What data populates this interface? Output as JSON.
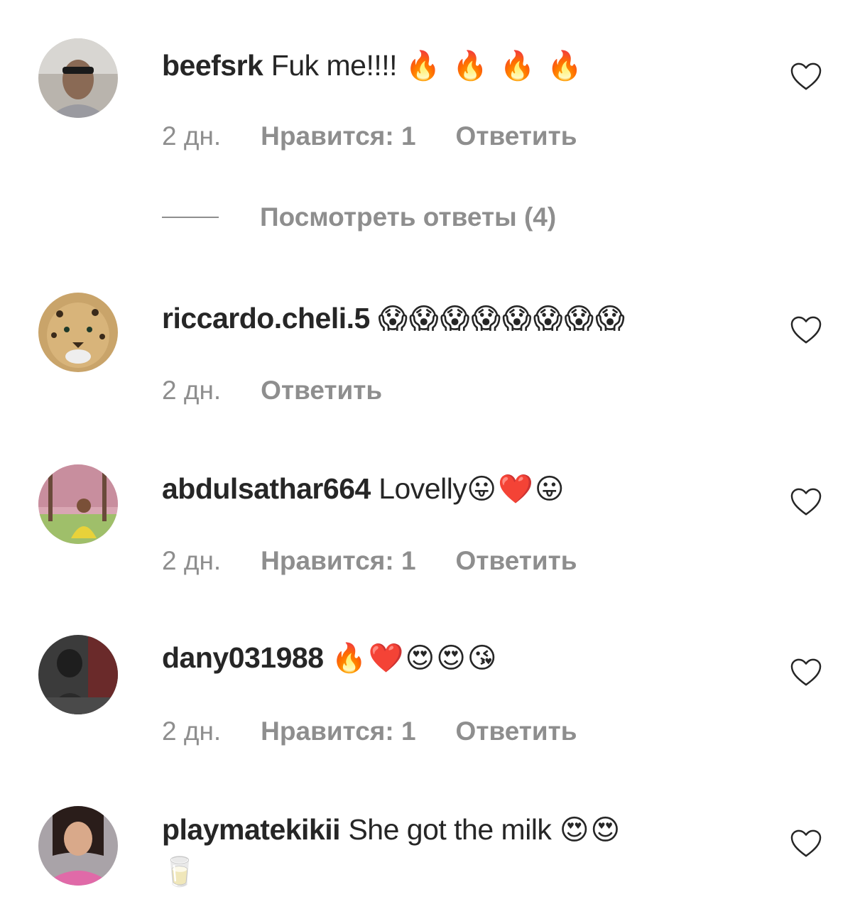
{
  "comments": [
    {
      "username": "beefsrk",
      "text": "Fuk me!!!!",
      "emojis": "🔥 🔥 🔥 🔥",
      "time": "2 дн.",
      "likes": "Нравится: 1",
      "reply": "Ответить",
      "view_replies": "Посмотреть ответы (4)"
    },
    {
      "username": "riccardo.cheli.5",
      "text": "",
      "emojis": "😱😱😱😱😱😱😱😱",
      "time": "2 дн.",
      "reply": "Ответить"
    },
    {
      "username": "abdulsathar664",
      "text": "Lovelly",
      "emojis": "😛❤️😛",
      "time": "2 дн.",
      "likes": "Нравится: 1",
      "reply": "Ответить"
    },
    {
      "username": "dany031988",
      "text": "",
      "emojis": "🔥❤️😍😍😘",
      "time": "2 дн.",
      "likes": "Нравится: 1",
      "reply": "Ответить"
    },
    {
      "username": "playmatekikii",
      "text": "She got the milk",
      "emojis": "😍😍",
      "emojis_line2": "🥛"
    }
  ],
  "colors": {
    "text": "#262626",
    "secondary": "#8e8e8e",
    "background": "#ffffff"
  },
  "icons": {
    "like": "heart-outline-icon"
  }
}
